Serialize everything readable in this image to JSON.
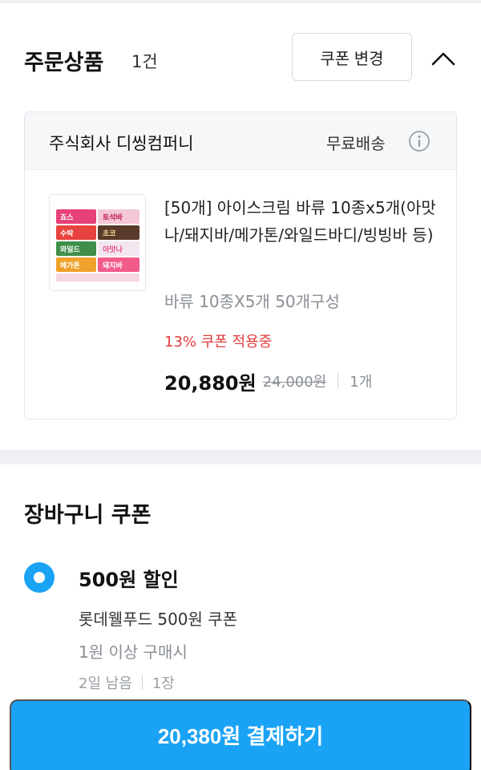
{
  "order": {
    "title": "주문상품",
    "count": "1건",
    "coupon_change_label": "쿠폰 변경",
    "collapse_icon": "chevron-up-icon"
  },
  "seller": {
    "name": "주식회사 디씽컴퍼니",
    "shipping": "무료배송",
    "info_icon": "info-icon"
  },
  "product": {
    "title": "[50개] 아이스크림 바류 10종x5개(아맛나/돼지바/메가톤/와일드바디/빙빙바 등)",
    "option": "바류 10종X5개 50개구성",
    "coupon_applied": "13% 쿠폰 적용중",
    "sale_price": "20,880원",
    "original_price": "24,000원",
    "quantity": "1개",
    "thumb_labels": [
      "죠스",
      "토석바",
      "수박",
      "초코",
      "와일드",
      "아맛나",
      "메가톤",
      "돼지바"
    ]
  },
  "cart_coupon": {
    "title": "장바구니 쿠폰",
    "selected": true,
    "name": "500원 할인",
    "description": "롯데웰푸드 500원 쿠폰",
    "condition": "1원 이상 구매시",
    "remaining": "2일 남음",
    "count": "1장"
  },
  "pay_button": {
    "label": "20,380원 결제하기"
  },
  "colors": {
    "accent": "#1aa3f5",
    "coupon_red": "#e03c3c",
    "muted": "#8a8f96"
  }
}
